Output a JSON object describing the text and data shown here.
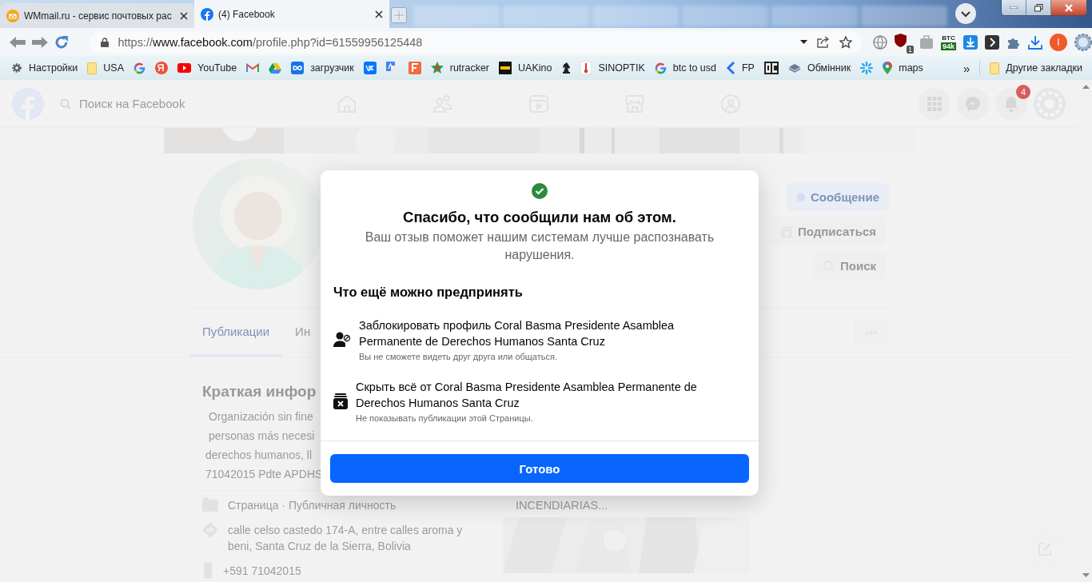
{
  "browser_tabs": [
    {
      "title": "WMmail.ru - сервис почтовых рас",
      "selected": false
    },
    {
      "title": "(4) Facebook",
      "selected": true
    }
  ],
  "address_bar": {
    "scheme": "https://",
    "host": "www.facebook.com",
    "path": "/profile.php?id=61559956125448"
  },
  "extensions": {
    "ublock_badge": "1",
    "btc_label": "BTC",
    "btc_badge": "94k",
    "profile_initial": "I"
  },
  "bookmarks": [
    {
      "kind": "labeled",
      "label": "Настройки"
    },
    {
      "kind": "labeled",
      "label": "USA"
    },
    {
      "kind": "icon_only"
    },
    {
      "kind": "icon_only"
    },
    {
      "kind": "labeled",
      "label": "YouTube"
    },
    {
      "kind": "icon_only"
    },
    {
      "kind": "icon_only"
    },
    {
      "kind": "labeled",
      "label": "загрузчик"
    },
    {
      "kind": "icon_only"
    },
    {
      "kind": "icon_only"
    },
    {
      "kind": "icon_only"
    },
    {
      "kind": "labeled",
      "label": "rutracker"
    },
    {
      "kind": "labeled",
      "label": "UAKino"
    },
    {
      "kind": "icon_only"
    },
    {
      "kind": "labeled",
      "label": "SINOPTIK"
    },
    {
      "kind": "labeled",
      "label": "btc to usd"
    },
    {
      "kind": "labeled",
      "label": "FP"
    },
    {
      "kind": "icon_only"
    },
    {
      "kind": "labeled",
      "label": "Обмінник"
    },
    {
      "kind": "icon_only"
    },
    {
      "kind": "labeled",
      "label": "maps"
    }
  ],
  "bookmarks_more": "»",
  "other_bookmarks": "Другие закладки",
  "facebook": {
    "search_placeholder": "Поиск на Facebook",
    "notification_count": "4",
    "profile_buttons": [
      {
        "label": "Сообщение",
        "kind": "primary"
      },
      {
        "label": "Подписаться",
        "kind": "follow"
      },
      {
        "label": "Поиск",
        "kind": "search"
      }
    ],
    "profile_tabs": [
      {
        "label": "Публикации",
        "selected": true
      },
      {
        "label": "Ин",
        "selected": false
      }
    ],
    "intro_title": "Краткая инфор",
    "bio_lines": [
      "Organización sin fine",
      "personas más necesi",
      "derechos humanos, ll",
      "71042015 Pdte APDHS"
    ],
    "details": [
      {
        "kind": "page",
        "text": "Страница · Публичная личность"
      },
      {
        "kind": "address",
        "text": "calle celso castedo 174-A, entre calles aroma y beni, Santa Cruz de la Sierra, Bolivia"
      },
      {
        "kind": "phone",
        "text": "+591 71042015"
      }
    ],
    "post_preview": "INCENDIARIAS..."
  },
  "dialog": {
    "title": "Спасибо, что сообщили нам об этом.",
    "subtitle": "Ваш отзыв поможет нашим системам лучше распознавать нарушения.",
    "section_title": "Что ещё можно предпринять",
    "options": [
      {
        "kind": "block",
        "title": "Заблокировать профиль Coral Basma Presidente Asamblea Permanente de Derechos Humanos Santa Cruz",
        "description": "Вы не сможете видеть друг друга или общаться."
      },
      {
        "kind": "hide",
        "title": "Скрыть всё от Coral Basma Presidente Asamblea Permanente de Derechos Humanos Santa Cruz",
        "description": "Не показывать публикации этой Страницы."
      }
    ],
    "done_button": "Готово"
  }
}
